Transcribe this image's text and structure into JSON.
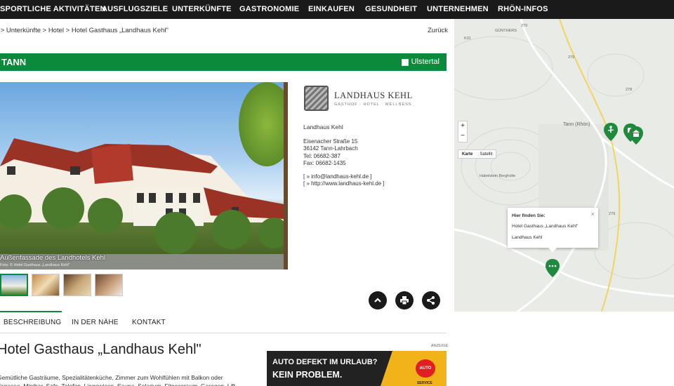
{
  "nav": [
    "SPORTLICHE AKTIVITÄTEN",
    "AUSFLUGSZIELE",
    "UNTERKÜNFTE",
    "GASTRONOMIE",
    "EINKAUFEN",
    "GESUNDHEIT",
    "UNTERNEHMEN",
    "RHÖN-INFOS"
  ],
  "breadcrumb": "Start  > Unterkünfte  > Hotel  > Hotel Gasthaus „Landhaus Kehl\"",
  "back_label": "Zurück",
  "place": {
    "name": "TANN",
    "toggle_label": "Ulstertal"
  },
  "photo": {
    "caption": "Außenfassade des Landhotels Kehl",
    "credit": "Foto: © Hotel Gasthaus „Landhaus Kehl\""
  },
  "logo": {
    "name": "LANDHAUS KEHL",
    "subtitle": "GASTHOF · HOTEL · WELLNESS"
  },
  "contact": {
    "title": "Landhaus Kehl",
    "street": "Eisenacher Straße 15",
    "city": "36142 Tann-Lahrbach",
    "tel": "Tel: 06682-387",
    "fax": "Fax: 06682-1435",
    "email": "[ » info@landhaus-kehl.de ]",
    "web": "[ » http://www.landhaus-kehl.de ]"
  },
  "tabs": [
    "BESCHREIBUNG",
    "IN DER NÄHE",
    "KONTAKT"
  ],
  "heading": "Hotel Gasthaus „Landhaus Kehl\"",
  "body_text": "Gemütliche Gasträume, Spezialitätenküche, Zimmer zum Wohlfühlen mit Balkon oder Terrasse, Minibar, Safe, Telefon, Liegewiese, Sauna, Solarium, Fitnessraum, Garagen, Lift",
  "ad": {
    "label": "ANZEIGE",
    "line1": "AUTO DEFEKT IM URLAUB?",
    "line2": "KEIN PROBLEM.",
    "badge": "AUTO",
    "service": "SERVICE"
  },
  "map": {
    "zoom_in": "+",
    "zoom_out": "−",
    "type_map": "Karte",
    "type_sat": "Satellit",
    "labels": [
      "GÜNTHERS",
      "Tann (Rhön)",
      "Habelstein Berghütte",
      "K31",
      "279",
      "278",
      "279",
      "279"
    ],
    "info": {
      "title": "Hier finden Sie:",
      "line1": "Hotel Gasthaus „Landhaus Kehl\"",
      "line2": "Landhaus Kehl",
      "close": "×"
    }
  },
  "colors": {
    "nav_bg": "#1a1a1a",
    "accent_green": "#0a8a3a",
    "ad_yellow": "#f2b21a"
  }
}
